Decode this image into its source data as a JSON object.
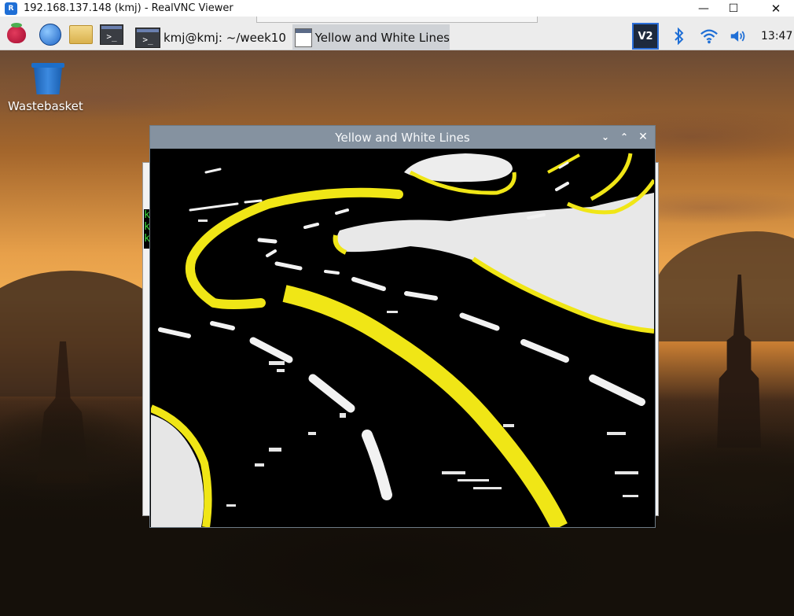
{
  "vnc_window": {
    "title": "192.168.137.148 (kmj) - RealVNC Viewer",
    "logo_text": "R",
    "minimize_glyph": "—",
    "maximize_glyph": "☐",
    "close_glyph": "✕"
  },
  "panel": {
    "launchers": [
      {
        "name": "raspberry-menu-icon"
      },
      {
        "name": "web-browser-icon"
      },
      {
        "name": "file-manager-icon"
      },
      {
        "name": "terminal-icon"
      }
    ],
    "tasks": [
      {
        "label": "kmj@kmj: ~/week10",
        "icon": "terminal-icon",
        "active": false
      },
      {
        "label": "Yellow and White Lines",
        "icon": "window-icon",
        "active": true
      }
    ],
    "tray": {
      "vnc_label": "V2",
      "bluetooth_icon": "bluetooth-icon",
      "wifi_icon": "wifi-icon",
      "volume_icon": "volume-icon",
      "clock": "13:47"
    }
  },
  "desktop": {
    "icons": [
      {
        "label": "Wastebasket",
        "icon": "trash-icon"
      }
    ]
  },
  "background_terminal": {
    "lines": [
      "k",
      "k",
      "k"
    ]
  },
  "main_window": {
    "title": "Yellow and White Lines",
    "buttons": {
      "minimize": "⌄",
      "maximize": "⌃",
      "close": "✕"
    },
    "colors": {
      "yellow_line": "#f0e616",
      "white_line": "#f2f2f2",
      "background": "#000000"
    }
  }
}
